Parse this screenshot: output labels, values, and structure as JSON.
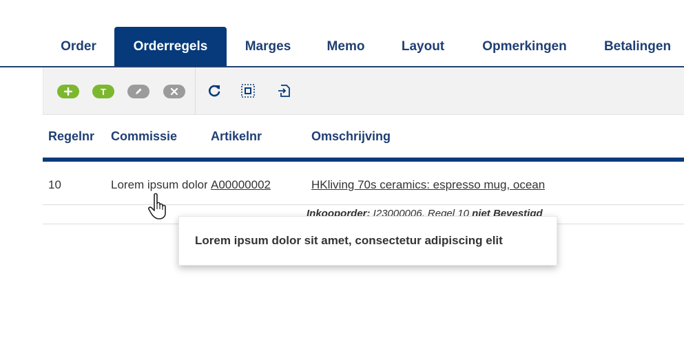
{
  "tabs": [
    {
      "label": "Order",
      "active": false
    },
    {
      "label": "Orderregels",
      "active": true
    },
    {
      "label": "Marges",
      "active": false
    },
    {
      "label": "Memo",
      "active": false
    },
    {
      "label": "Layout",
      "active": false
    },
    {
      "label": "Opmerkingen",
      "active": false
    },
    {
      "label": "Betalingen",
      "active": false
    }
  ],
  "toolbar": {
    "add_icon": "plus-icon",
    "text_label": "T",
    "edit_icon": "pencil-icon",
    "delete_icon": "x-icon",
    "refresh_icon": "refresh-icon",
    "select_icon": "select-all-icon",
    "export_icon": "export-icon"
  },
  "table": {
    "columns": [
      "Regelnr",
      "Commissie",
      "Artikelnr",
      "Omschrijving"
    ],
    "rows": [
      {
        "regelnr": "10",
        "commissie": "Lorem ipsum dolor sit amet, consectetur adipiscing elit",
        "artikelnr": "A00000002",
        "omschrijving": "HKliving 70s ceramics: espresso mug, ocean",
        "sub_label": "Inkooporder:",
        "sub_value": " I23000006, Regel 10 ",
        "sub_status": "niet Bevestigd"
      }
    ]
  },
  "tooltip": {
    "text": "Lorem ipsum dolor sit amet, consectetur adipiscing elit"
  },
  "colors": {
    "primary": "#063a7a",
    "tab_text": "#1f3f73",
    "green": "#7cb82f",
    "gray": "#9b9b9b"
  }
}
